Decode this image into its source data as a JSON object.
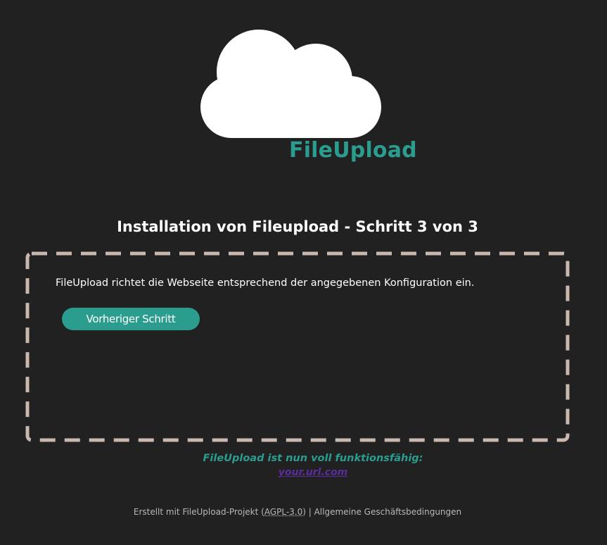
{
  "brand": {
    "name": "FileUpload",
    "logo_icon": "cloud-icon",
    "color": "#2a9d8f"
  },
  "title": "Installation von Fileupload - Schritt 3 von 3",
  "install_box": {
    "message": "FileUpload richtet die Webseite entsprechend der angegebenen Konfiguration ein.",
    "prev_button_label": "Vorheriger Schritt",
    "border_color": "#c9b8b0"
  },
  "status": {
    "text": "FileUpload ist nun voll funktionsfähig:",
    "link_label": "your.url.com"
  },
  "footer": {
    "prefix": "Erstellt mit FileUpload-Projekt (",
    "license": "AGPL-3.0",
    "suffix": ") | ",
    "terms_label": "Allgemeine Geschäftsbedingungen"
  },
  "colors": {
    "background": "#212121",
    "accent": "#2a9d8f",
    "link": "#5b2c9b"
  }
}
